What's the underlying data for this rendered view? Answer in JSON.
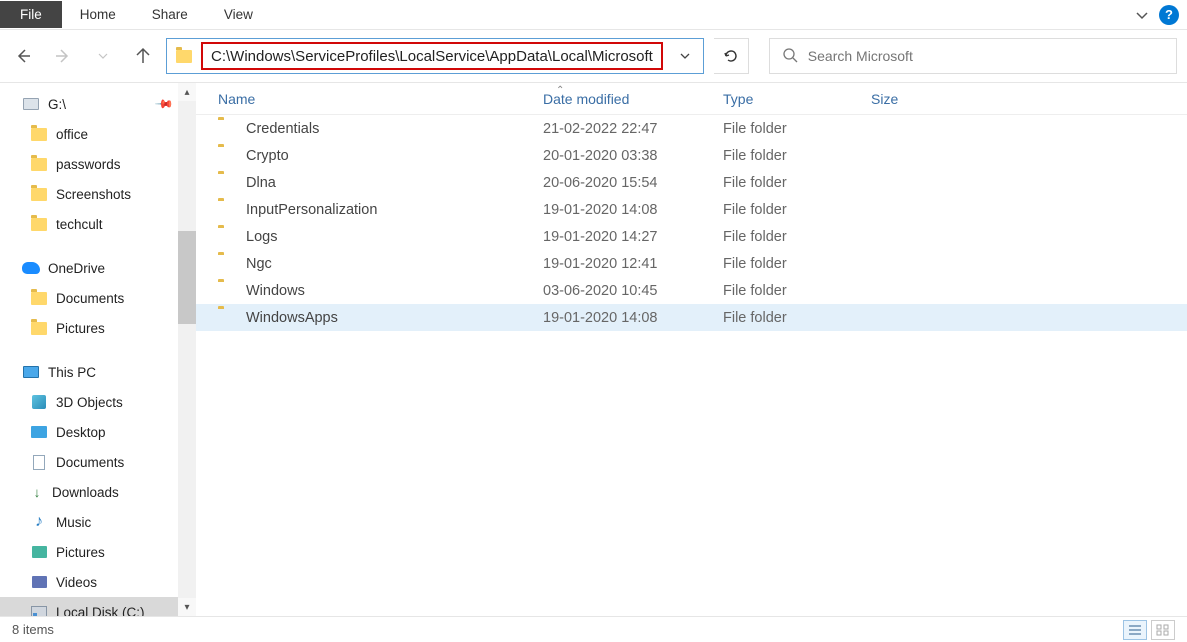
{
  "ribbon": {
    "file": "File",
    "home": "Home",
    "share": "Share",
    "view": "View"
  },
  "address": {
    "path": "C:\\Windows\\ServiceProfiles\\LocalService\\AppData\\Local\\Microsoft"
  },
  "search": {
    "placeholder": "Search Microsoft"
  },
  "tree": {
    "gdrive": "G:\\",
    "office": "office",
    "passwords": "passwords",
    "screenshots": "Screenshots",
    "techcult": "techcult",
    "onedrive": "OneDrive",
    "documents": "Documents",
    "pictures": "Pictures",
    "thispc": "This PC",
    "objects3d": "3D Objects",
    "desktop": "Desktop",
    "documents2": "Documents",
    "downloads": "Downloads",
    "music": "Music",
    "pictures2": "Pictures",
    "videos": "Videos",
    "localdisk": "Local Disk (C:)"
  },
  "columns": {
    "name": "Name",
    "date": "Date modified",
    "type": "Type",
    "size": "Size"
  },
  "rows": [
    {
      "name": "Credentials",
      "date": "21-02-2022 22:47",
      "type": "File folder"
    },
    {
      "name": "Crypto",
      "date": "20-01-2020 03:38",
      "type": "File folder"
    },
    {
      "name": "Dlna",
      "date": "20-06-2020 15:54",
      "type": "File folder"
    },
    {
      "name": "InputPersonalization",
      "date": "19-01-2020 14:08",
      "type": "File folder"
    },
    {
      "name": "Logs",
      "date": "19-01-2020 14:27",
      "type": "File folder"
    },
    {
      "name": "Ngc",
      "date": "19-01-2020 12:41",
      "type": "File folder"
    },
    {
      "name": "Windows",
      "date": "03-06-2020 10:45",
      "type": "File folder"
    },
    {
      "name": "WindowsApps",
      "date": "19-01-2020 14:08",
      "type": "File folder"
    }
  ],
  "status": {
    "items": "8 items"
  }
}
